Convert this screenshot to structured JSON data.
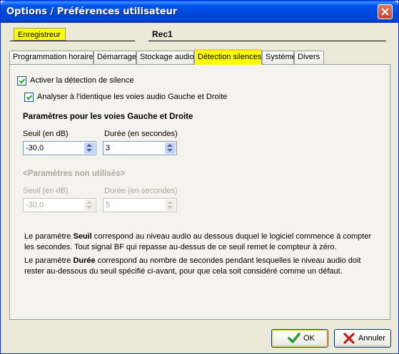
{
  "window": {
    "title": "Options / Préférences utilisateur"
  },
  "recorder": {
    "label": "Enregistreur",
    "name": "Rec1"
  },
  "tabs": [
    {
      "label": "Programmation horaire"
    },
    {
      "label": "Démarrage"
    },
    {
      "label": "Stockage audio"
    },
    {
      "label": "Détection silences",
      "active": true
    },
    {
      "label": "Système"
    },
    {
      "label": "Divers"
    }
  ],
  "options": {
    "enable_silence": {
      "label": "Activer la détection de silence",
      "checked": true
    },
    "identical_lr": {
      "label": "Analyser à l'identique les voies audio Gauche et Droite",
      "checked": true
    }
  },
  "lr_params": {
    "heading": "Paramètres pour les voies Gauche et Droite",
    "threshold_label": "Seuil (en dB)",
    "threshold_value": "-30,0",
    "duration_label": "Durée (en secondes)",
    "duration_value": "3"
  },
  "unused_params": {
    "heading": "<Paramètres non utilisés>",
    "threshold_label": "Seuil (en dB)",
    "threshold_value": "-30,0",
    "duration_label": "Durée (en secondes)",
    "duration_value": "5"
  },
  "help": {
    "p1_before": "Le paramètre ",
    "p1_bold": "Seuil",
    "p1_after": " correspond au niveau audio au dessous duquel le logiciel commence à compter les secondes. Tout signal BF qui repasse au-dessus de ce seuil remet le compteur à zéro.",
    "p2_before": "Le paramètre ",
    "p2_bold": "Durée",
    "p2_after": " correspond au nombre de secondes pendant lesquelles le niveau audio doit rester au-dessous du seuil spécifié ci-avant, pour que cela soit considéré comme un défaut."
  },
  "buttons": {
    "ok": "OK",
    "cancel": "Annuler"
  },
  "icons": {
    "ok": "checkmark-icon",
    "cancel": "x-icon",
    "close": "close-icon"
  },
  "colors": {
    "active_tab": "#FFFF00",
    "titlebar": "#0054E3",
    "ok_check": "#2E9A2E",
    "cancel_x": "#C0201A"
  }
}
